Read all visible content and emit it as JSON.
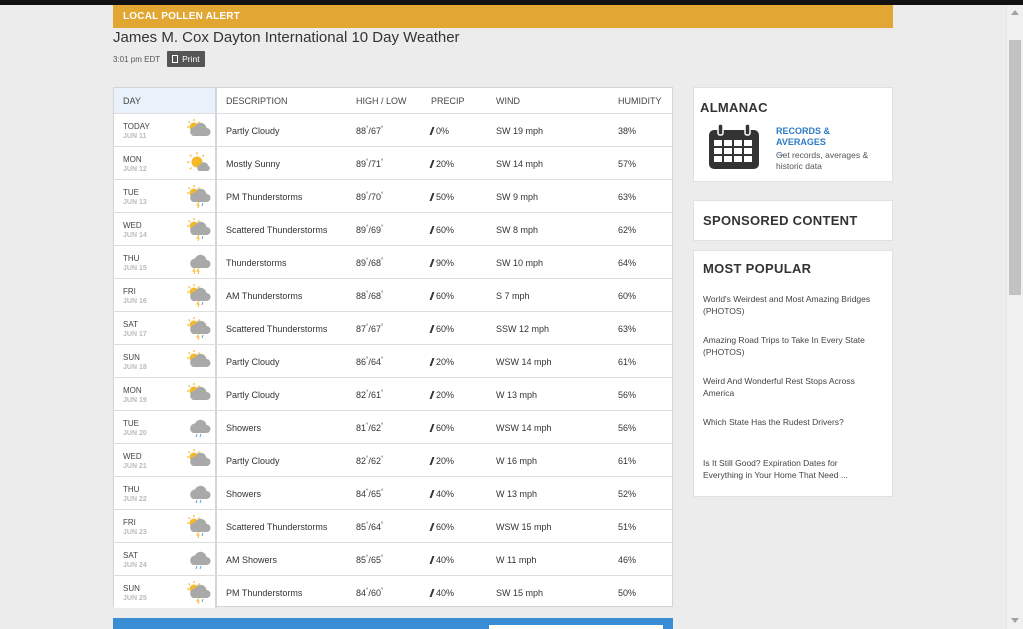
{
  "alert": {
    "label": "LOCAL POLLEN ALERT"
  },
  "page": {
    "title": "James M. Cox Dayton International 10 Day Weather",
    "time": "3:01 pm EDT",
    "print_label": "Print"
  },
  "table": {
    "headers": {
      "day": "DAY",
      "description": "DESCRIPTION",
      "highlow": "HIGH / LOW",
      "precip": "PRECIP",
      "wind": "WIND",
      "humidity": "HUMIDITY"
    },
    "rows": [
      {
        "day": "TODAY",
        "date": "JUN 11",
        "icon": "partly-cloudy-icon",
        "description": "Partly Cloudy",
        "high": "88",
        "low": "67",
        "precip": "0%",
        "wind": "SW 19 mph",
        "humidity": "38%"
      },
      {
        "day": "MON",
        "date": "JUN 12",
        "icon": "mostly-sunny-icon",
        "description": "Mostly Sunny",
        "high": "89",
        "low": "71",
        "precip": "20%",
        "wind": "SW 14 mph",
        "humidity": "57%"
      },
      {
        "day": "TUE",
        "date": "JUN 13",
        "icon": "pm-thunderstorms-icon",
        "description": "PM Thunderstorms",
        "high": "89",
        "low": "70",
        "precip": "50%",
        "wind": "SW 9 mph",
        "humidity": "63%"
      },
      {
        "day": "WED",
        "date": "JUN 14",
        "icon": "scattered-thunderstorms-icon",
        "description": "Scattered Thunderstorms",
        "high": "89",
        "low": "69",
        "precip": "60%",
        "wind": "SW 8 mph",
        "humidity": "62%"
      },
      {
        "day": "THU",
        "date": "JUN 15",
        "icon": "thunderstorms-icon",
        "description": "Thunderstorms",
        "high": "89",
        "low": "68",
        "precip": "90%",
        "wind": "SW 10 mph",
        "humidity": "64%"
      },
      {
        "day": "FRI",
        "date": "JUN 16",
        "icon": "am-thunderstorms-icon",
        "description": "AM Thunderstorms",
        "high": "88",
        "low": "68",
        "precip": "60%",
        "wind": "S 7 mph",
        "humidity": "60%"
      },
      {
        "day": "SAT",
        "date": "JUN 17",
        "icon": "scattered-thunderstorms-icon",
        "description": "Scattered Thunderstorms",
        "high": "87",
        "low": "67",
        "precip": "60%",
        "wind": "SSW 12 mph",
        "humidity": "63%"
      },
      {
        "day": "SUN",
        "date": "JUN 18",
        "icon": "partly-cloudy-icon",
        "description": "Partly Cloudy",
        "high": "86",
        "low": "64",
        "precip": "20%",
        "wind": "WSW 14 mph",
        "humidity": "61%"
      },
      {
        "day": "MON",
        "date": "JUN 19",
        "icon": "partly-cloudy-icon",
        "description": "Partly Cloudy",
        "high": "82",
        "low": "61",
        "precip": "20%",
        "wind": "W 13 mph",
        "humidity": "56%"
      },
      {
        "day": "TUE",
        "date": "JUN 20",
        "icon": "showers-icon",
        "description": "Showers",
        "high": "81",
        "low": "62",
        "precip": "60%",
        "wind": "WSW 14 mph",
        "humidity": "56%"
      },
      {
        "day": "WED",
        "date": "JUN 21",
        "icon": "partly-cloudy-icon",
        "description": "Partly Cloudy",
        "high": "82",
        "low": "62",
        "precip": "20%",
        "wind": "W 16 mph",
        "humidity": "61%"
      },
      {
        "day": "THU",
        "date": "JUN 22",
        "icon": "showers-icon",
        "description": "Showers",
        "high": "84",
        "low": "65",
        "precip": "40%",
        "wind": "W 13 mph",
        "humidity": "52%"
      },
      {
        "day": "FRI",
        "date": "JUN 23",
        "icon": "scattered-thunderstorms-icon",
        "description": "Scattered Thunderstorms",
        "high": "85",
        "low": "64",
        "precip": "60%",
        "wind": "WSW 15 mph",
        "humidity": "51%"
      },
      {
        "day": "SAT",
        "date": "JUN 24",
        "icon": "am-showers-icon",
        "description": "AM Showers",
        "high": "85",
        "low": "65",
        "precip": "40%",
        "wind": "W 11 mph",
        "humidity": "46%"
      },
      {
        "day": "SUN",
        "date": "JUN 25",
        "icon": "pm-thunderstorms-icon",
        "description": "PM Thunderstorms",
        "high": "84",
        "low": "60",
        "precip": "40%",
        "wind": "SW 15 mph",
        "humidity": "50%"
      }
    ]
  },
  "almanac": {
    "title": "ALMANAC",
    "link": "RECORDS & AVERAGES →",
    "description": "Get records, averages & historic data"
  },
  "sponsored": {
    "title": "SPONSORED CONTENT"
  },
  "popular": {
    "title": "MOST POPULAR",
    "items": [
      "World's Weirdest and Most Amazing Bridges (PHOTOS)",
      "Amazing Road Trips to Take In Every State (PHOTOS)",
      "Weird And Wonderful Rest Stops Across America",
      "Which State Has the Rudest Drivers?",
      "Is It Still Good? Expiration Dates for Everything in Your Home That Need ..."
    ]
  },
  "colors": {
    "alert": "#e2a633",
    "link": "#2e7bc4",
    "footer_bar": "#3a8ed6"
  }
}
